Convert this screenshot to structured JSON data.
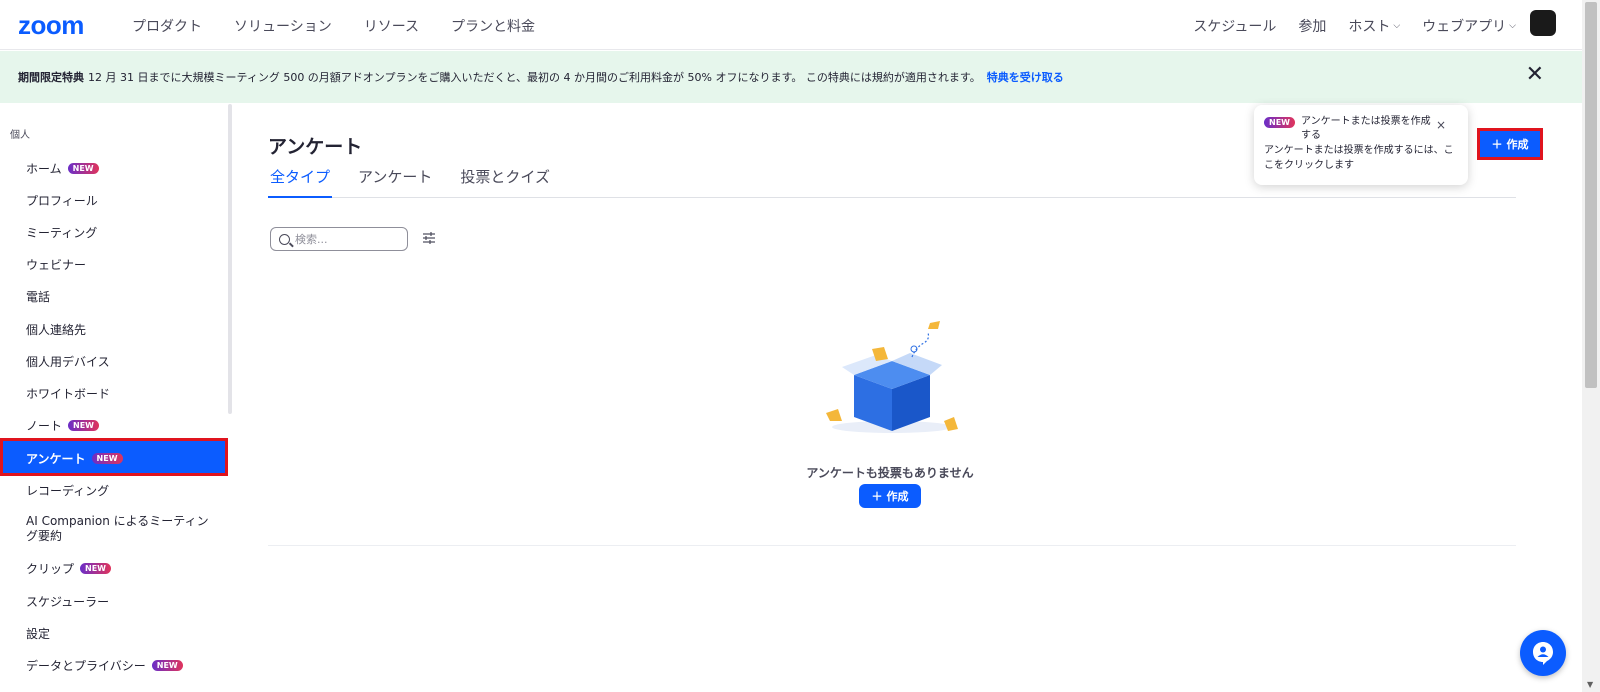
{
  "header": {
    "logo": "zoom",
    "nav_left": [
      "プロダクト",
      "ソリューション",
      "リソース",
      "プランと料金"
    ],
    "nav_right": {
      "schedule": "スケジュール",
      "join": "参加",
      "host": "ホスト",
      "webapp": "ウェブアプリ"
    }
  },
  "banner": {
    "bold": "期間限定特典",
    "text": "12 月 31 日までに大規模ミーティング 500 の月額アドオンプランをご購入いただくと、最初の 4 か月間のご利用料金が 50% オフになります。 この特典には規約が適用されます。",
    "link": "特典を受け取る",
    "close": "✕"
  },
  "sidebar": {
    "section": "個人",
    "items": [
      {
        "label": "ホーム",
        "badge": "NEW"
      },
      {
        "label": "プロフィール"
      },
      {
        "label": "ミーティング"
      },
      {
        "label": "ウェビナー"
      },
      {
        "label": "電話"
      },
      {
        "label": "個人連絡先"
      },
      {
        "label": "個人用デバイス"
      },
      {
        "label": "ホワイトボード"
      },
      {
        "label": "ノート",
        "badge": "NEW"
      },
      {
        "label": "アンケート",
        "badge": "NEW"
      },
      {
        "label": "レコーディング"
      },
      {
        "label": "AI Companion によるミーティング要約"
      },
      {
        "label": "クリップ",
        "badge": "NEW"
      },
      {
        "label": "スケジューラー"
      },
      {
        "label": "設定"
      },
      {
        "label": "データとプライバシー",
        "badge": "NEW"
      }
    ]
  },
  "main": {
    "title": "アンケート",
    "tabs": [
      "全タイプ",
      "アンケート",
      "投票とクイズ"
    ],
    "search_placeholder": "検索...",
    "empty_text": "アンケートも投票もありません",
    "create_label": "作成"
  },
  "tooltip": {
    "badge": "NEW",
    "title": "アンケートまたは投票を作成する",
    "body": "アンケートまたは投票を作成するには、ここをクリックします",
    "close": "×"
  },
  "create_button": {
    "label": "作成"
  },
  "colors": {
    "brand": "#0b5cff",
    "highlight": "#e0141e",
    "banner_bg": "#e6f6ec"
  }
}
